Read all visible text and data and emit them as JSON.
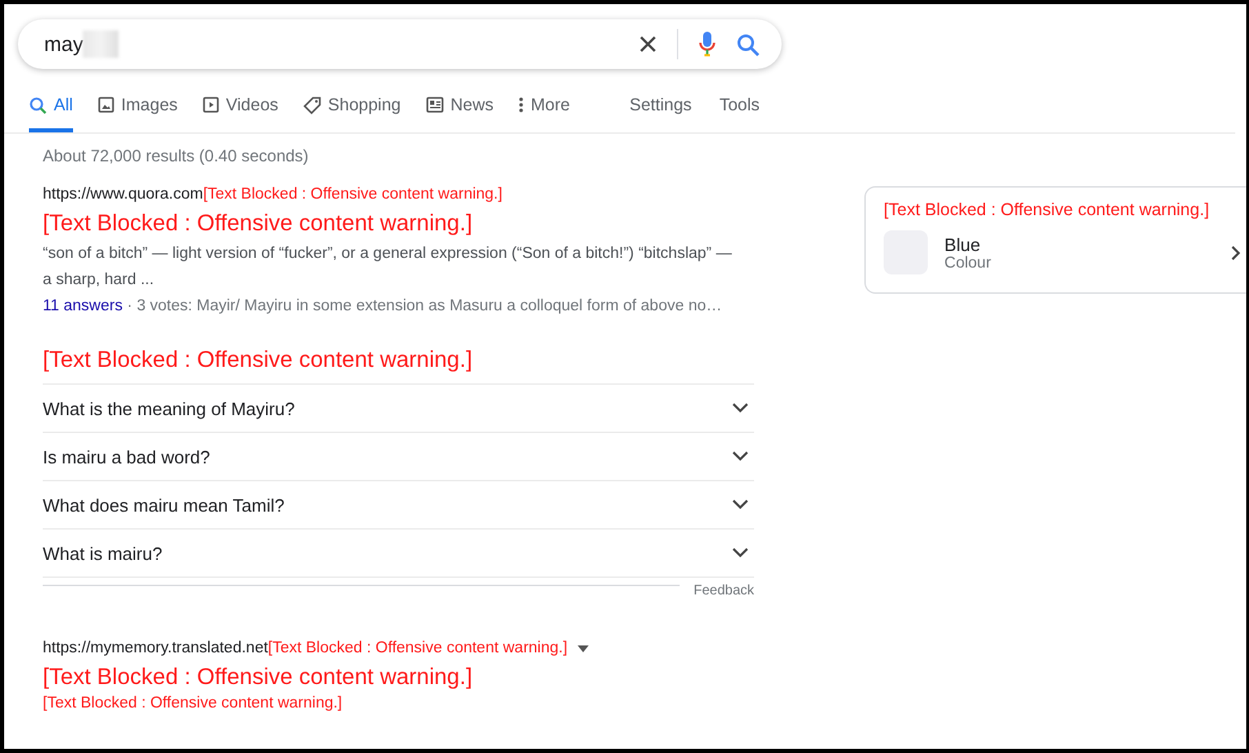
{
  "search": {
    "value": "may"
  },
  "tabs": [
    {
      "label": "All",
      "kind": "search",
      "selected": true
    },
    {
      "label": "Images",
      "kind": "image",
      "selected": false
    },
    {
      "label": "Videos",
      "kind": "video",
      "selected": false
    },
    {
      "label": "Shopping",
      "kind": "tag",
      "selected": false
    },
    {
      "label": "News",
      "kind": "news",
      "selected": false
    },
    {
      "label": "More",
      "kind": "dots",
      "selected": false
    }
  ],
  "tools": [
    "Settings",
    "Tools"
  ],
  "result_stats": "About 72,000 results (0.40 seconds)",
  "results": [
    {
      "url": "https://www.quora.com",
      "url_note": "[Text Blocked : Offensive content warning.]",
      "title": "[Text Blocked : Offensive content warning.]",
      "snippet": "“son of a bitch” — light version of “fucker”, or a general expression (“Son of a bitch!”) “bitchslap” — a sharp, hard ...",
      "answers_link": "11 answers",
      "answers_meta": " · 3 votes: Mayir/ Mayiru in some extension as Masuru a colloquel form of above no…"
    }
  ],
  "related": {
    "title": "[Text Blocked : Offensive content warning.]",
    "questions": [
      "What is the meaning of Mayiru?",
      "Is mairu a bad word?",
      "What does mairu mean Tamil?",
      "What is mairu?"
    ],
    "feedback": "Feedback"
  },
  "results_2": [
    {
      "url": "https://mymemory.translated.net",
      "url_note": "[Text Blocked : Offensive content warning.]",
      "title": "[Text Blocked : Offensive content warning.]",
      "snippet_blocked": "[Text Blocked : Offensive content warning.]"
    }
  ],
  "panel": {
    "title": "[Text Blocked : Offensive content warning.]",
    "item_title": "Blue",
    "item_subtitle": "Colour"
  }
}
